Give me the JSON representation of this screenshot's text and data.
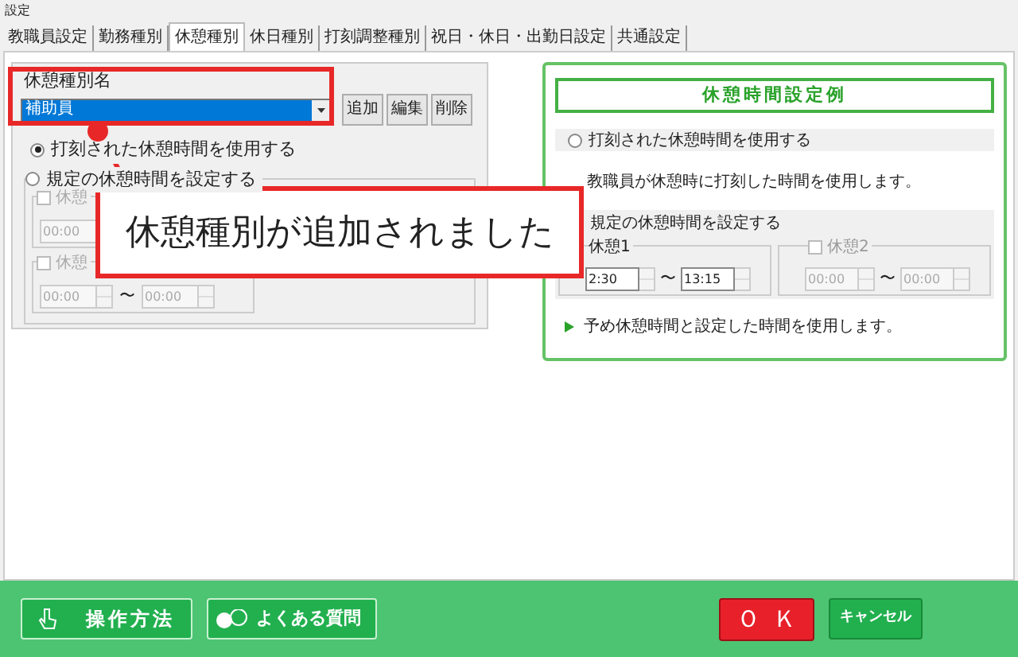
{
  "window": {
    "title": "設定"
  },
  "tabs": [
    {
      "label": "教職員設定",
      "selected": false
    },
    {
      "label": "勤務種別",
      "selected": false
    },
    {
      "label": "休憩種別",
      "selected": true
    },
    {
      "label": "休日種別",
      "selected": false
    },
    {
      "label": "打刻調整種別",
      "selected": false
    },
    {
      "label": "祝日・休日・出勤日設定",
      "selected": false
    },
    {
      "label": "共通設定",
      "selected": false
    }
  ],
  "break_type": {
    "label": "休憩種別名",
    "value": "補助員",
    "buttons": [
      "追加",
      "編集",
      "削除"
    ]
  },
  "left_options": {
    "stamped": {
      "label": "打刻された休憩時間を使用する",
      "selected": true
    },
    "fixed": {
      "label": "規定の休憩時間を設定する",
      "selected": false
    },
    "breaks": [
      {
        "label": "休憩",
        "checked": false,
        "disabled": true,
        "from": "00:00"
      },
      {
        "label": "休憩",
        "checked": false,
        "disabled": true,
        "from": "00:00",
        "separator": "〜",
        "to": "00:00"
      }
    ]
  },
  "example": {
    "title": "休憩時間設定例",
    "stamped": {
      "label": "打刻された休憩時間を使用する",
      "selected": false
    },
    "stamped_note": "教職員が休憩時に打刻した時間を使用します。",
    "fixed_label": "規定の休憩時間を設定する",
    "breaks": [
      {
        "label": "休憩1",
        "disabled": false,
        "from": "2:30",
        "separator": "〜",
        "to": "13:15"
      },
      {
        "label": "休憩2",
        "checked": false,
        "disabled": true,
        "from": "00:00",
        "separator": "〜",
        "to": "00:00"
      }
    ],
    "fixed_note": "予め休憩時間と設定した時間を使用します。"
  },
  "callout": "休憩種別が追加されました",
  "footer": {
    "help": "操作方法",
    "faq": "よくある質問",
    "ok": "ＯＫ",
    "cancel": "キャンセル"
  }
}
